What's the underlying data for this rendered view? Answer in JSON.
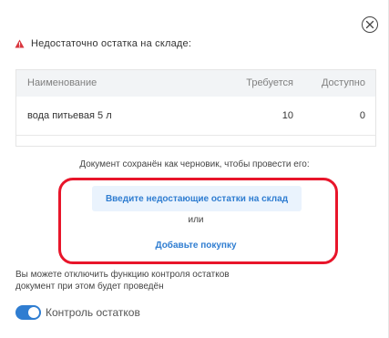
{
  "dialog": {
    "warning_text": "Недостаточно остатка на складе:",
    "accent_color": "#2f7dd1",
    "warning_color": "#d9363e",
    "annotation_color": "#e8152a"
  },
  "table": {
    "headers": {
      "name": "Наименование",
      "required": "Требуется",
      "available": "Доступно"
    },
    "rows": [
      {
        "name": "вода питьевая 5 л",
        "required": "10",
        "available": "0"
      }
    ]
  },
  "note": "Документ сохранён как черновик, чтобы провести его:",
  "actions": {
    "enter_stock": "Введите недостающие остатки на склад",
    "or": "или",
    "add_purchase": "Добавьте покупку"
  },
  "info_lines": [
    "Вы можете отключить функцию контроля остатков",
    "документ при этом будет проведён"
  ],
  "toggle": {
    "label": "Контроль остатков",
    "state": "on"
  },
  "icons": {
    "close": "close-icon",
    "warning": "warning-triangle-icon"
  }
}
